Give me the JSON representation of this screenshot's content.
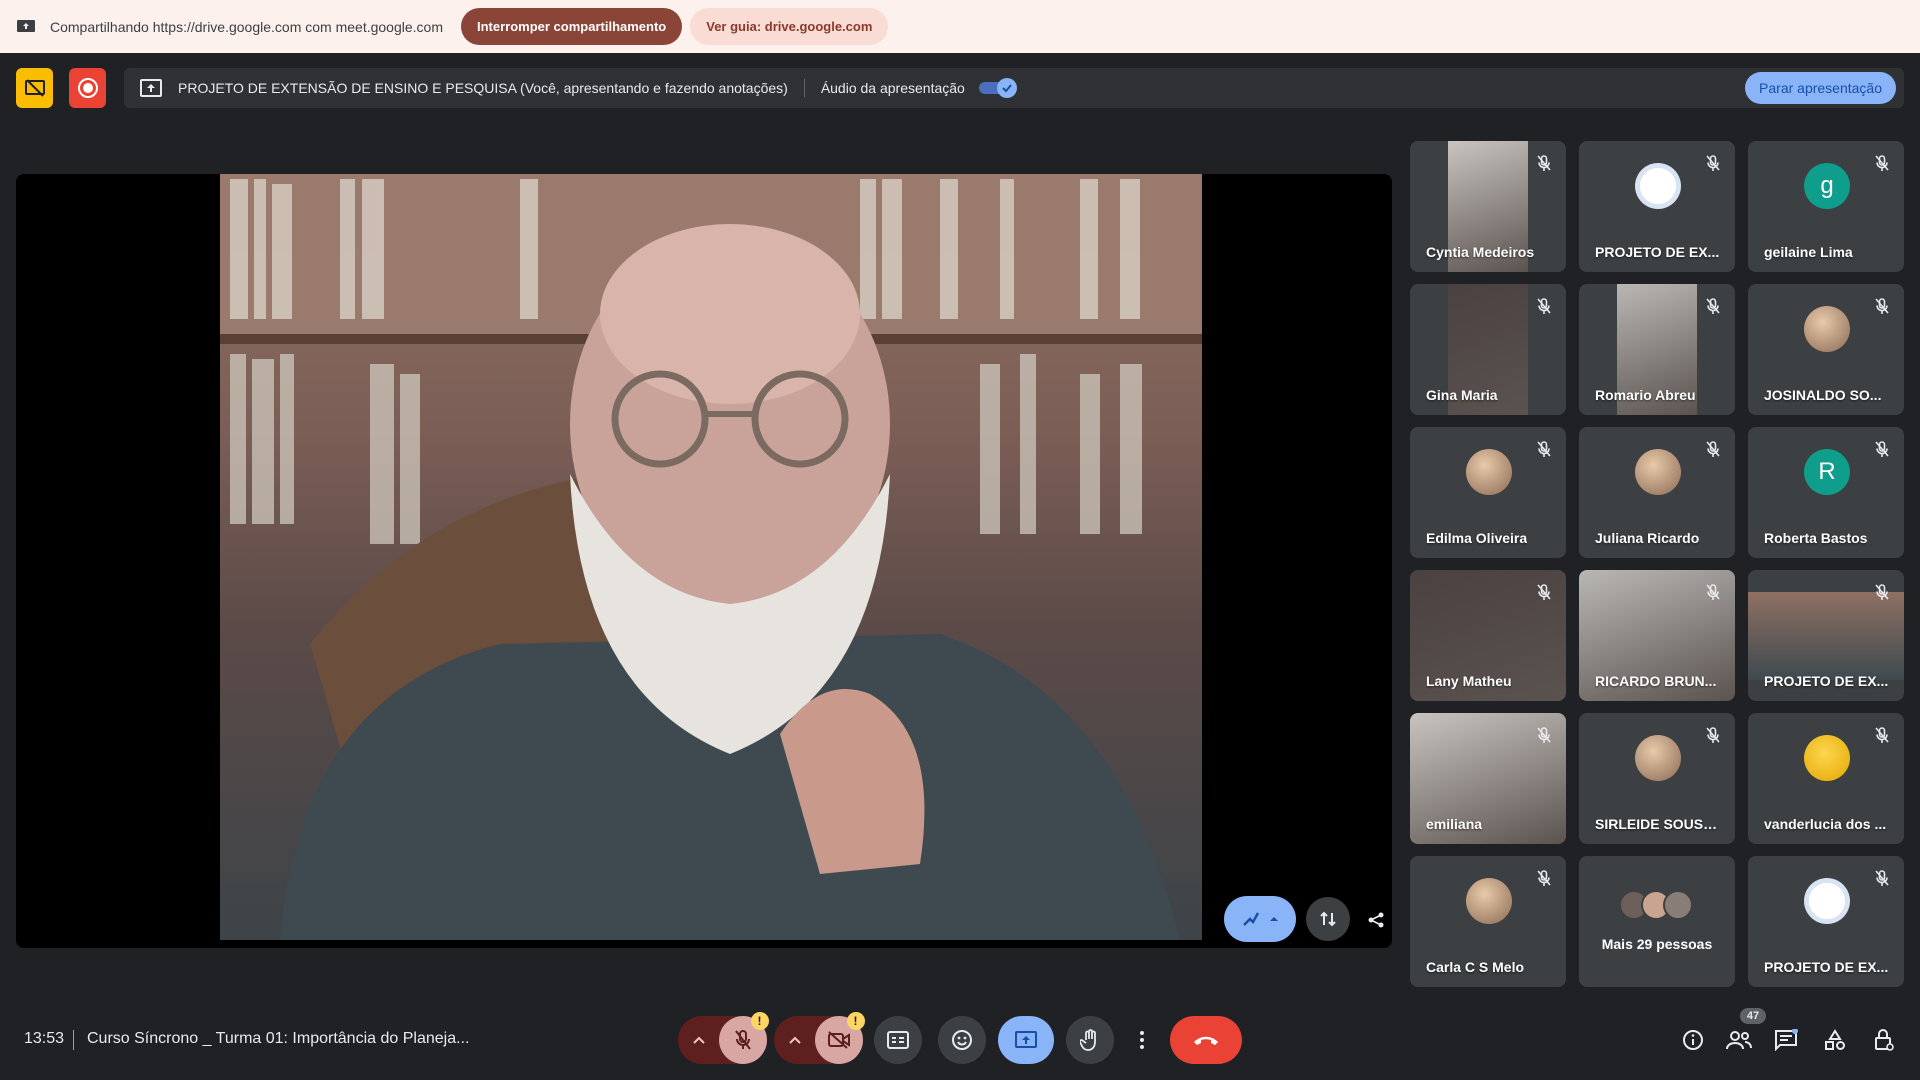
{
  "share_bar": {
    "sharing_text": "Compartilhando https://drive.google.com com meet.google.com",
    "stop_sharing_label": "Interromper compartilhamento",
    "view_tab_label": "Ver guia: drive.google.com"
  },
  "presentation": {
    "title": "PROJETO DE EXTENSÃO DE ENSINO E PESQUISA (Você, apresentando e fazendo anotações)",
    "audio_label": "Áudio da apresentação",
    "audio_enabled": true,
    "stop_label": "Parar apresentação"
  },
  "participants": [
    {
      "name": "Cyntia Medeiros",
      "kind": "photo",
      "muted": true
    },
    {
      "name": "PROJETO DE EX...",
      "kind": "logo",
      "muted": true
    },
    {
      "name": "geilaine Lima",
      "kind": "letter",
      "letter": "g",
      "color": "#0f9d8c",
      "muted": true
    },
    {
      "name": "Gina Maria",
      "kind": "photo",
      "muted": true
    },
    {
      "name": "Romario Abreu",
      "kind": "photo",
      "muted": true
    },
    {
      "name": "JOSINALDO SO...",
      "kind": "avatar",
      "muted": true
    },
    {
      "name": "Edilma Oliveira",
      "kind": "avatar",
      "muted": true
    },
    {
      "name": "Juliana Ricardo",
      "kind": "avatar",
      "muted": true
    },
    {
      "name": "Roberta Bastos",
      "kind": "letter",
      "letter": "R",
      "color": "#0f9d8c",
      "muted": true
    },
    {
      "name": "Lany Matheu",
      "kind": "photo",
      "muted": true
    },
    {
      "name": "RICARDO BRUN...",
      "kind": "photo",
      "muted": true
    },
    {
      "name": "PROJETO DE EX...",
      "kind": "photo",
      "muted": true
    },
    {
      "name": "emiliana",
      "kind": "photo",
      "muted": true
    },
    {
      "name": "SIRLEIDE SOUSA ...",
      "kind": "avatar",
      "muted": true
    },
    {
      "name": "vanderlucia dos ...",
      "kind": "avatar",
      "muted": true
    },
    {
      "name": "Carla C S Melo",
      "kind": "avatar",
      "muted": true
    },
    {
      "name": "Mais 29 pessoas",
      "kind": "more",
      "muted": false
    },
    {
      "name": "PROJETO DE EX...",
      "kind": "logo",
      "muted": true
    }
  ],
  "bottom": {
    "time": "13:53",
    "meeting_name": "Curso Síncrono _ Turma 01: Importância do Planeja...",
    "people_count": "47"
  },
  "colors": {
    "background": "#202124",
    "accent": "#8ab4f8",
    "danger": "#ea4335"
  },
  "icons": [
    "present-icon",
    "record-icon",
    "mic-off-icon",
    "camera-off-icon",
    "captions-icon",
    "emoji-icon",
    "present-screen-icon",
    "raise-hand-icon",
    "more-options-icon",
    "end-call-icon",
    "info-icon",
    "people-icon",
    "chat-icon",
    "activities-icon",
    "host-controls-icon"
  ]
}
